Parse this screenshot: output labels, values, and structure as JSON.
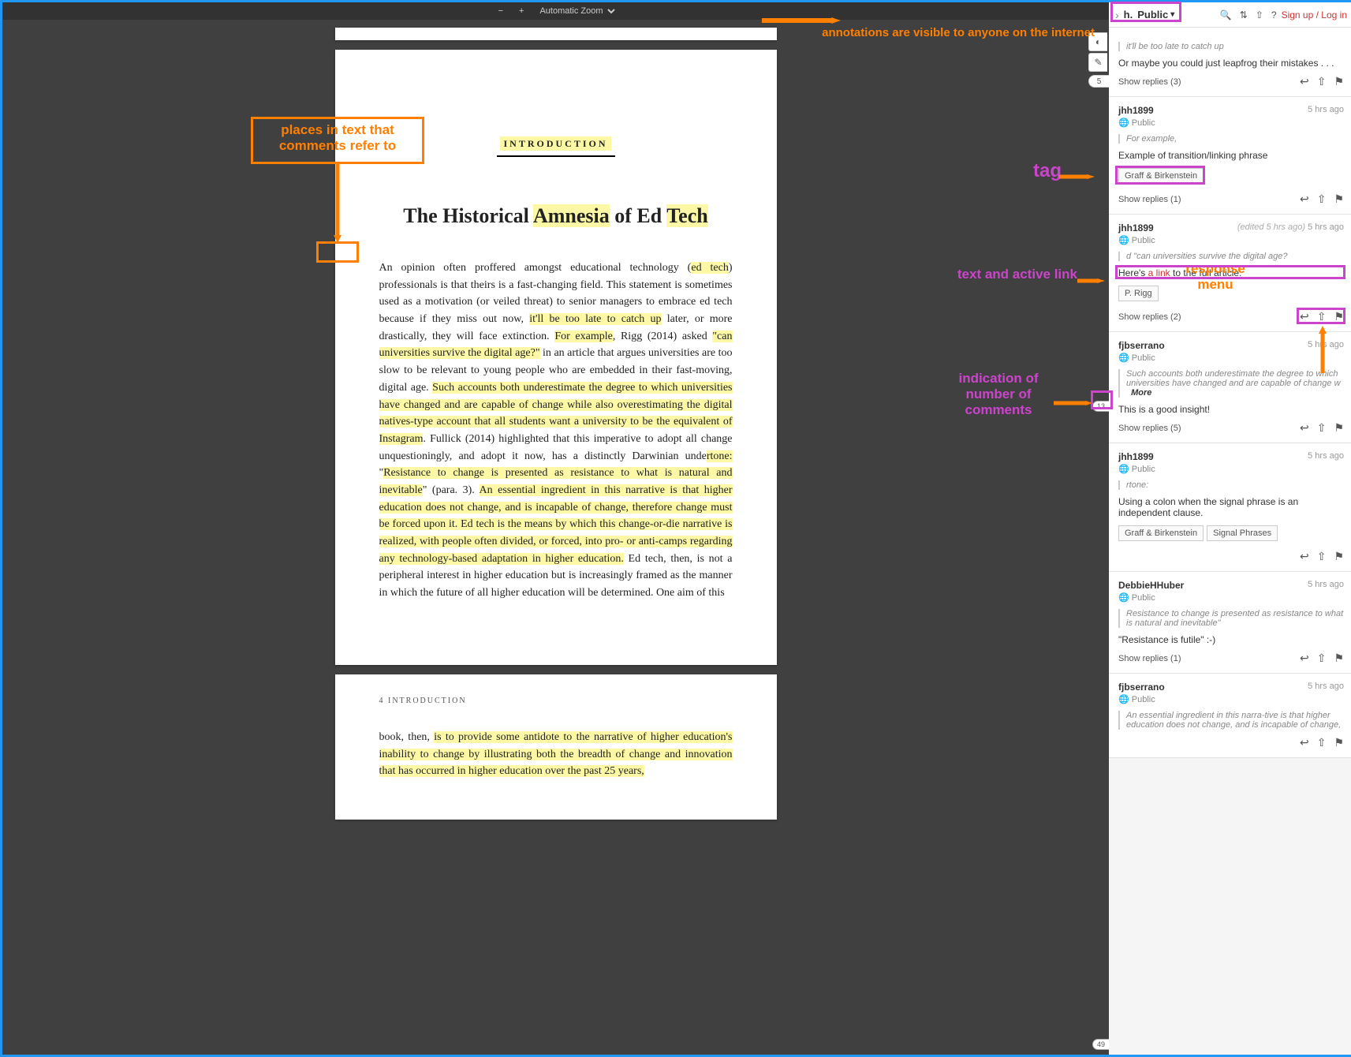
{
  "toolbar": {
    "zoom": "Automatic Zoom"
  },
  "doc": {
    "intro": "INTRODUCTION",
    "title_pre": "The Historical ",
    "title_hl1": "Amnesia",
    "title_mid": " of Ed ",
    "title_hl2": "Tech",
    "p2_header": "4     INTRODUCTION"
  },
  "edge": {
    "count_top": "5",
    "bucket1": "13",
    "bucket2": "49"
  },
  "callouts": {
    "public_note": "annotations are visible to anyone on the internet",
    "places": "places in text that comments refer to",
    "tag": "tag",
    "textlink": "text and active link",
    "respmenu": "response menu",
    "numcomments": "indication of number of comments"
  },
  "sb": {
    "group": "Public",
    "signup": "Sign up",
    "login": "Log in"
  },
  "annotations": [
    {
      "partial": true,
      "quote": "it'll be too late to catch up",
      "body": "Or maybe you could just leapfrog their mistakes . . .",
      "replies": "Show replies (3)"
    },
    {
      "user": "jhh1899",
      "time": "5 hrs ago",
      "vis": "Public",
      "quote": "For example,",
      "body": "Example of transition/linking phrase",
      "tags": [
        "Graff & Birkenstein"
      ],
      "replies": "Show replies (1)"
    },
    {
      "user": "jhh1899",
      "time": "5 hrs ago",
      "edited": "(edited 5 hrs ago)",
      "vis": "Public",
      "quote": "d \"can universities survive the digital age?",
      "body_pre": "Here's ",
      "body_link": "a link ",
      "body_post": "to the full article.",
      "tags": [
        "P. Rigg"
      ],
      "replies": "Show replies (2)"
    },
    {
      "user": "fjbserrano",
      "time": "5 hrs ago",
      "vis": "Public",
      "quote": "Such accounts both underestimate the degree to which universities have changed and are capable of change w",
      "more": "More",
      "body": "This is a good insight!",
      "replies": "Show replies (5)"
    },
    {
      "user": "jhh1899",
      "time": "5 hrs ago",
      "vis": "Public",
      "quote": "rtone:",
      "body": "Using a colon when the signal phrase is an independent clause.",
      "tags": [
        "Graff & Birkenstein",
        "Signal Phrases"
      ],
      "replies": ""
    },
    {
      "user": "DebbieHHuber",
      "time": "5 hrs ago",
      "vis": "Public",
      "quote": "Resistance to change is presented as resistance to what is natural and inevitable\"",
      "body": "\"Resistance is futile\" :-)",
      "replies": "Show replies (1)"
    },
    {
      "user": "fjbserrano",
      "time": "5 hrs ago",
      "vis": "Public",
      "quote": "An essential ingredient in this narra-tive is that higher education does not change, and is incapable of change,",
      "body": "",
      "replies": ""
    }
  ]
}
